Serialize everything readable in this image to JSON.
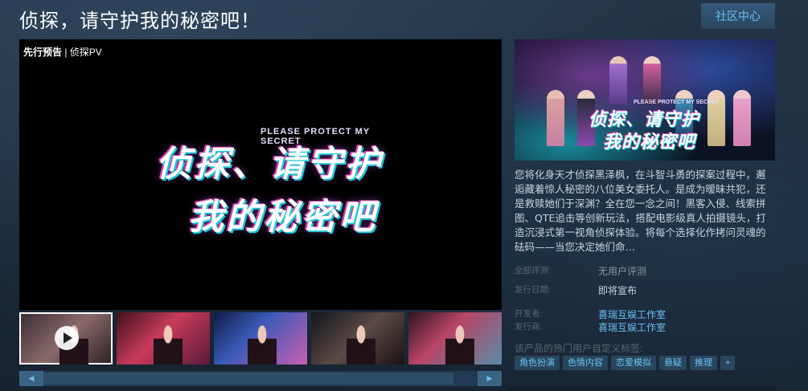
{
  "page": {
    "title": "侦探，请守护我的秘密吧！",
    "community_button": "社区中心"
  },
  "player": {
    "label_bold": "先行预告",
    "label_rest": " | 侦探PV",
    "logo_subtitle": "PLEASE PROTECT MY SECRET",
    "logo_line1": "侦探、请守护",
    "logo_line2": "我的秘密吧"
  },
  "thumbnails": [
    {
      "kind": "video",
      "icon": "play-icon"
    },
    {
      "kind": "screenshot"
    },
    {
      "kind": "screenshot"
    },
    {
      "kind": "screenshot"
    },
    {
      "kind": "screenshot"
    }
  ],
  "capsule": {
    "subtitle": "PLEASE PROTECT MY SECRET",
    "logo_line1": "侦探、请守护",
    "logo_line2": "我的秘密吧"
  },
  "description": "您将化身天才侦探黑泽枫，在斗智斗勇的探案过程中，邂逅藏着惊人秘密的八位美女委托人。是成为暧昧共犯，还是救赎她们于深渊？全在您一念之间！黑客入侵、线索拼图、QTE追击等创新玩法，搭配电影级真人拍摄镜头，打造沉浸式第一视角侦探体验。将每个选择化作拷问灵魂的砝码——当您决定她们命…",
  "meta": {
    "reviews_label": "全部评测:",
    "reviews_value": "无用户评测",
    "release_label": "发行日期:",
    "release_value": "即将宣布",
    "developer_label": "开发者:",
    "developer_value": "喜瑞互娱工作室",
    "publisher_label": "发行商:",
    "publisher_value": "喜瑞互娱工作室"
  },
  "tags": {
    "label": "该产品的热门用户自定义标签:",
    "items": [
      "角色扮演",
      "色情内容",
      "恋爱模拟",
      "悬疑",
      "推理",
      "+"
    ]
  },
  "colors": {
    "background": "#1b2838",
    "link": "#67c1f5",
    "tag_bg": "#29465c"
  }
}
